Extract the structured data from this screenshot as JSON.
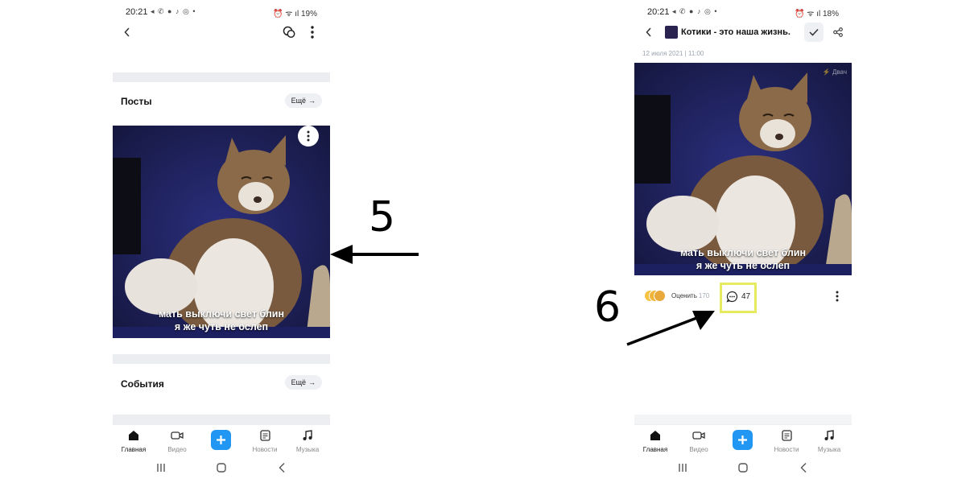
{
  "left_screen": {
    "status": {
      "time": "20:21",
      "app_icons": "◂ ✆ ● ♪ ◎ •",
      "battery": "19%"
    },
    "sections": {
      "posts": {
        "title": "Посты",
        "more": "Ещё"
      },
      "events": {
        "title": "События",
        "more": "Ещё"
      }
    },
    "meme": {
      "line1": "мать выключи свет блин",
      "line2": "я же чуть не ослеп"
    }
  },
  "right_screen": {
    "status": {
      "time": "20:21",
      "app_icons": "◂ ✆ ● ♪ ◎ •",
      "battery": "18%"
    },
    "post": {
      "title": "Котики - это наша жизнь.",
      "date": "12 июля 2021 | 11:00",
      "watermark": "Двач"
    },
    "meme": {
      "line1": "мать выключи свет блин",
      "line2": "я же чуть не ослеп"
    },
    "actions": {
      "rate_label": "Оценить",
      "rate_count": "170",
      "comments_count": "47"
    }
  },
  "bottom_nav": {
    "items": [
      {
        "label": "Главная",
        "icon": "home-icon"
      },
      {
        "label": "Видео",
        "icon": "video-icon"
      },
      {
        "label": "",
        "icon": "plus-icon"
      },
      {
        "label": "Новости",
        "icon": "news-icon"
      },
      {
        "label": "Музыка",
        "icon": "music-icon"
      }
    ]
  },
  "annotations": {
    "step5": "5",
    "step6": "6"
  },
  "colors": {
    "accent": "#2196f3",
    "highlight": "#e6ea5f",
    "section_gap": "#ebedf0"
  }
}
